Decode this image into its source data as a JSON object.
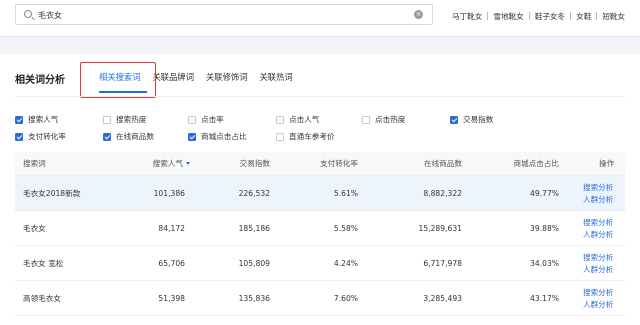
{
  "search": {
    "value": "毛衣女"
  },
  "hot_words": [
    "马丁靴女",
    "雪地靴女",
    "鞋子女冬",
    "女鞋",
    "短靴女"
  ],
  "section": {
    "title": "相关词分析",
    "tabs": [
      {
        "label": "相关搜索词",
        "active": true
      },
      {
        "label": "关联品牌词",
        "active": false
      },
      {
        "label": "关联修饰词",
        "active": false
      },
      {
        "label": "关联热词",
        "active": false
      }
    ]
  },
  "metrics": [
    {
      "label": "搜索人气",
      "checked": true
    },
    {
      "label": "搜索热度",
      "checked": false
    },
    {
      "label": "点击率",
      "checked": false
    },
    {
      "label": "点击人气",
      "checked": false
    },
    {
      "label": "点击热度",
      "checked": false
    },
    {
      "label": "交易指数",
      "checked": true
    },
    {
      "label": "支付转化率",
      "checked": true
    },
    {
      "label": "在线商品数",
      "checked": true
    },
    {
      "label": "商城点击占比",
      "checked": true
    },
    {
      "label": "直通车参考价",
      "checked": false
    }
  ],
  "table": {
    "headers": [
      "搜索词",
      "搜索人气",
      "交易指数",
      "支付转化率",
      "在线商品数",
      "商城点击占比",
      "操作"
    ],
    "rows": [
      [
        "毛衣女2018新款",
        "101,386",
        "226,532",
        "5.61%",
        "8,882,322",
        "49.77%"
      ],
      [
        "毛衣女",
        "84,172",
        "185,186",
        "5.58%",
        "15,289,631",
        "39.88%"
      ],
      [
        "毛衣女 宽松",
        "65,706",
        "105,809",
        "4.24%",
        "6,717,978",
        "34.03%"
      ],
      [
        "高领毛衣女",
        "51,398",
        "135,836",
        "7.60%",
        "3,285,493",
        "43.17%"
      ]
    ],
    "op_labels": [
      "搜索分析",
      "人群分析"
    ]
  },
  "colors": {
    "accent": "#2b6bd8",
    "highlight_box": "#e03b3b",
    "selected_row": "#eef4fe"
  },
  "icons": [
    "search-icon",
    "clear-icon",
    "sort-desc-icon"
  ]
}
